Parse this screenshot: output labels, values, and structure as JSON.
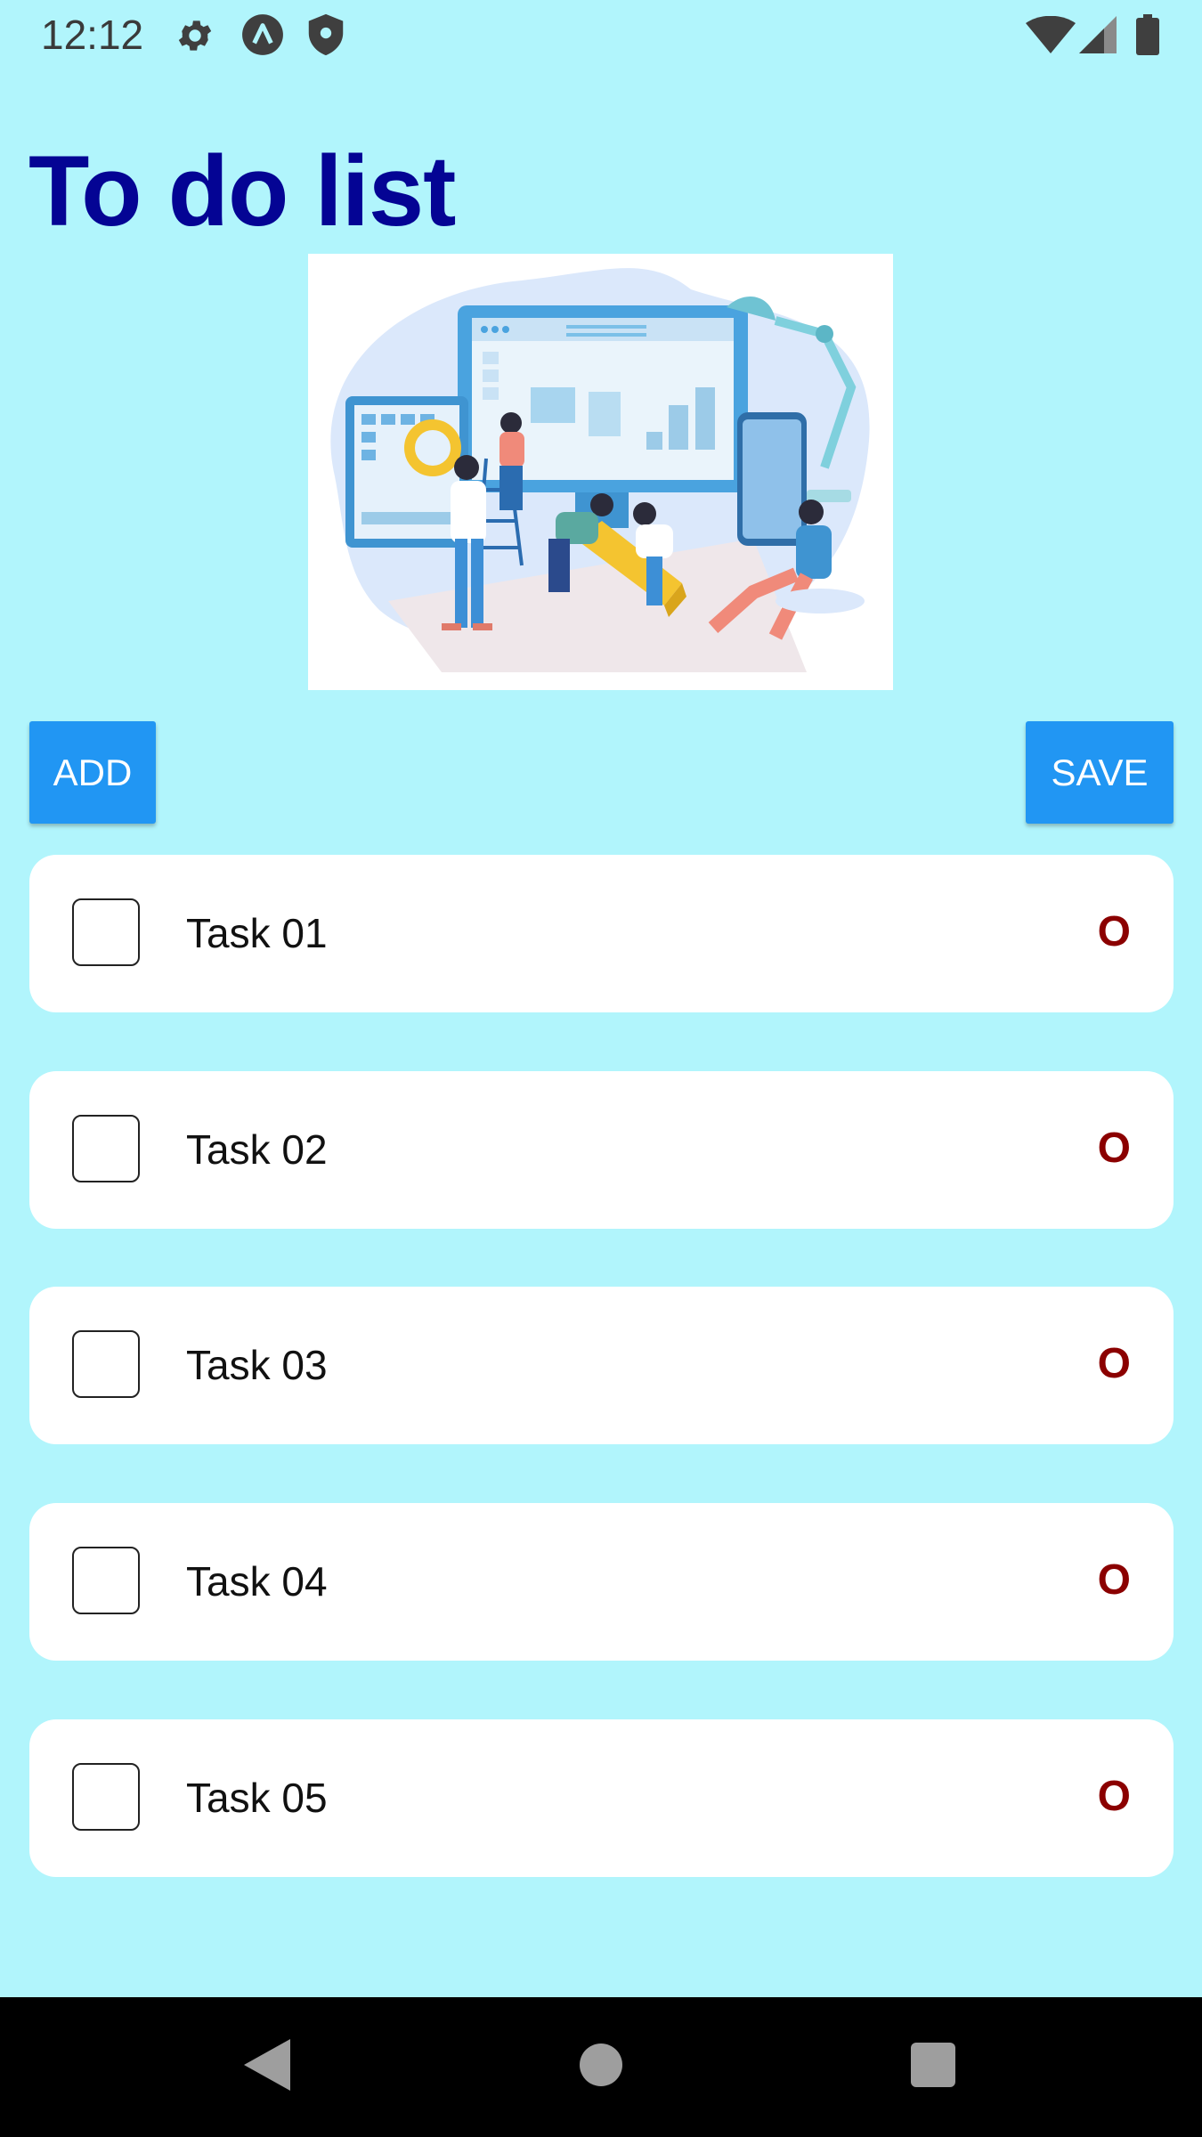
{
  "status_bar": {
    "time": "12:12",
    "icons_left": [
      "gear-icon",
      "app-badge-icon",
      "shield-icon"
    ],
    "icons_right": [
      "wifi-icon",
      "cellular-signal-icon",
      "battery-icon"
    ]
  },
  "header": {
    "title": "To do list"
  },
  "toolbar": {
    "add_label": "ADD",
    "save_label": "SAVE"
  },
  "tasks": [
    {
      "label": "Task 01",
      "checked": false,
      "action": "O"
    },
    {
      "label": "Task 02",
      "checked": false,
      "action": "O"
    },
    {
      "label": "Task 03",
      "checked": false,
      "action": "O"
    },
    {
      "label": "Task 04",
      "checked": false,
      "action": "O"
    },
    {
      "label": "Task 05",
      "checked": false,
      "action": "O"
    }
  ],
  "nav_bar": {
    "buttons": [
      "back-icon",
      "home-icon",
      "recents-icon"
    ]
  },
  "colors": {
    "background": "#B1F5FC",
    "title": "#040494",
    "button": "#2196F3",
    "delete": "#8B0000",
    "card": "#FFFFFF"
  }
}
